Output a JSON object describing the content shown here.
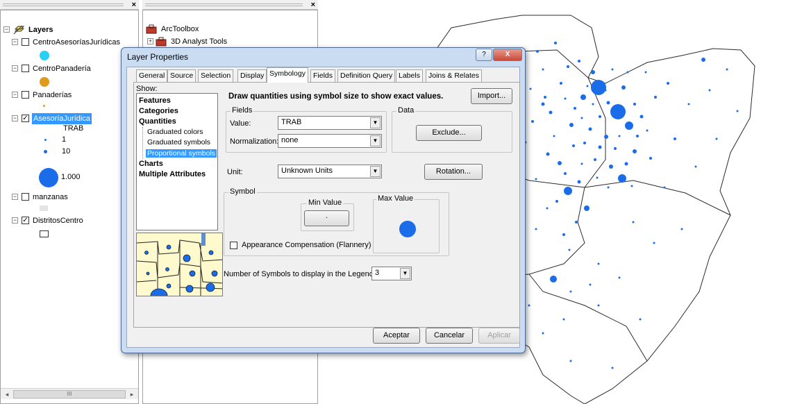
{
  "toc": {
    "root_label": "Layers",
    "layers": [
      {
        "name": "CentroAsesoríasJurídicas",
        "checked": false,
        "symbol_color": "#29d0f5"
      },
      {
        "name": "CentroPanadería",
        "checked": false,
        "symbol_color": "#e09a1c"
      },
      {
        "name": "Panaderías",
        "checked": false,
        "symbol_color": "#e09a1c"
      },
      {
        "name": "AsesoríaJurídica",
        "checked": true,
        "selected": true,
        "field": "TRAB",
        "legend": [
          {
            "label": "1"
          },
          {
            "label": "10"
          },
          {
            "label": "1.000"
          }
        ]
      },
      {
        "name": "manzanas",
        "checked": false
      },
      {
        "name": "DistritosCentro",
        "checked": true
      }
    ],
    "scroll_thumb": "III"
  },
  "toolbox": {
    "items": [
      "ArcToolbox",
      "3D Analyst Tools"
    ]
  },
  "dialog": {
    "title": "Layer Properties",
    "help_glyph": "?",
    "close_glyph": "X",
    "tabs": [
      "General",
      "Source",
      "Selection",
      "Display",
      "Symbology",
      "Fields",
      "Definition Query",
      "Labels",
      "Joins & Relates"
    ],
    "active_tab": "Symbology",
    "show_label": "Show:",
    "show_list": {
      "categories": [
        "Features",
        "Categories",
        "Quantities"
      ],
      "subcategories": [
        "Graduated colors",
        "Graduated symbols",
        "Proportional symbols"
      ],
      "selected_sub": "Proportional symbols",
      "more_categories": [
        "Charts",
        "Multiple Attributes"
      ]
    },
    "description": "Draw quantities using symbol size to show exact values.",
    "import_button": "Import...",
    "fields_group": "Fields",
    "value_label": "Value:",
    "value_field": "TRAB",
    "normalization_label": "Normalization:",
    "normalization_value": "none",
    "data_group": "Data",
    "exclude_button": "Exclude...",
    "unit_label": "Unit:",
    "unit_value": "Unknown Units",
    "rotation_button": "Rotation...",
    "symbol_group": "Symbol",
    "min_value_label": "Min Value",
    "min_value_button": ".",
    "max_value_label": "Max Value",
    "flannery_label": "Appearance Compensation (Flannery)",
    "legend_count_label": "Number of Symbols to display in the Legend:",
    "legend_count_value": "3",
    "accept_button": "Aceptar",
    "cancel_button": "Cancelar",
    "apply_button": "Aplicar"
  },
  "colors": {
    "point_blue": "#1a6ce8",
    "highlight": "#3399ff",
    "dialog_frame": "#c9dcf1",
    "close_red": "#c94a3a"
  }
}
